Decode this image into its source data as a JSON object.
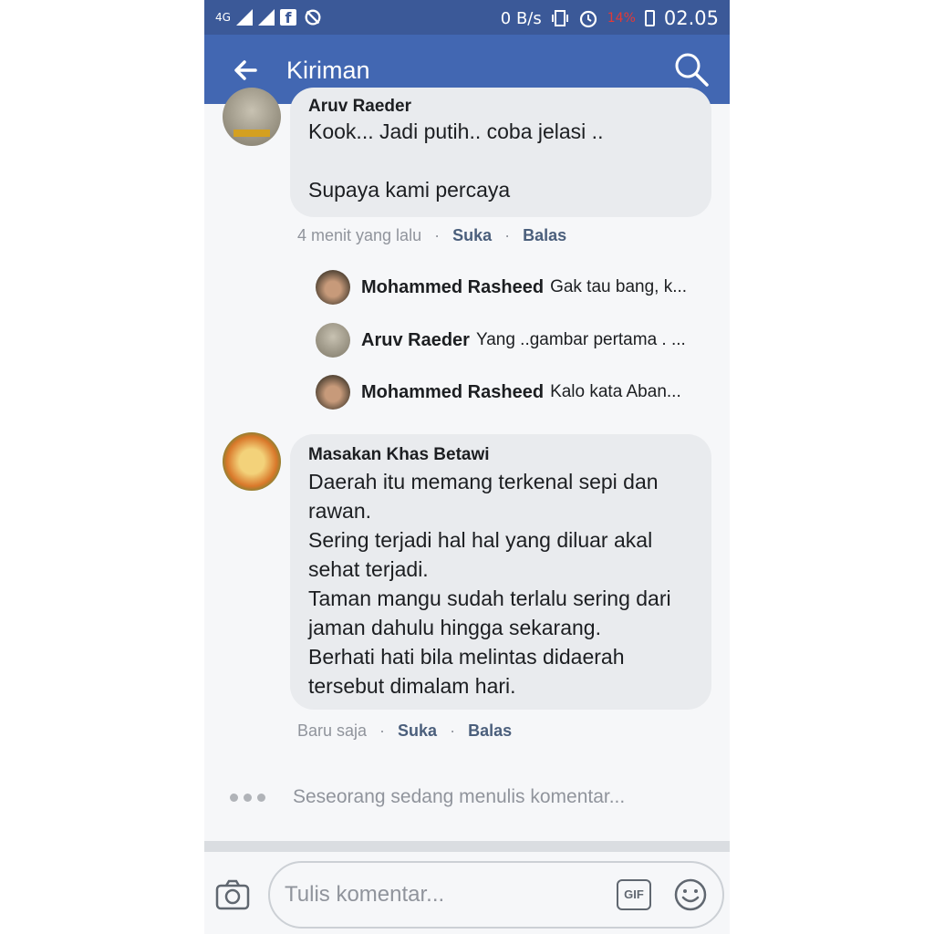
{
  "status_bar": {
    "network": "4G",
    "data_rate": "0 B/s",
    "battery": "14%",
    "time": "02.05"
  },
  "header": {
    "title": "Kiriman",
    "back_icon": "arrow-left-icon",
    "search_icon": "search-icon"
  },
  "comments": [
    {
      "author": "Aruv Raeder",
      "text": "Kook... Jadi putih.. coba jelasi ..\n\nSupaya kami percaya",
      "time": "4 menit yang lalu",
      "like": "Suka",
      "reply": "Balas"
    },
    {
      "author": "Masakan Khas Betawi",
      "text": "Daerah itu memang terkenal sepi dan rawan.\nSering terjadi hal hal yang diluar akal sehat terjadi.\nTaman mangu sudah terlalu sering dari jaman dahulu hingga sekarang.\nBerhati hati bila melintas didaerah tersebut dimalam hari.",
      "time": "Baru saja",
      "like": "Suka",
      "reply": "Balas"
    }
  ],
  "replies": [
    {
      "author": "Mohammed Rasheed",
      "text": "Gak tau bang, k..."
    },
    {
      "author": "Aruv Raeder",
      "text": "Yang ..gambar pertama . ..."
    },
    {
      "author": "Mohammed Rasheed",
      "text": "Kalo kata Aban..."
    }
  ],
  "typing_indicator": "Seseorang sedang menulis komentar...",
  "composer": {
    "placeholder": "Tulis komentar...",
    "gif_label": "GIF"
  },
  "colors": {
    "status_bar": "#3b5998",
    "header": "#4267b2",
    "bubble": "#e9ebee",
    "background": "#f6f7f9"
  }
}
